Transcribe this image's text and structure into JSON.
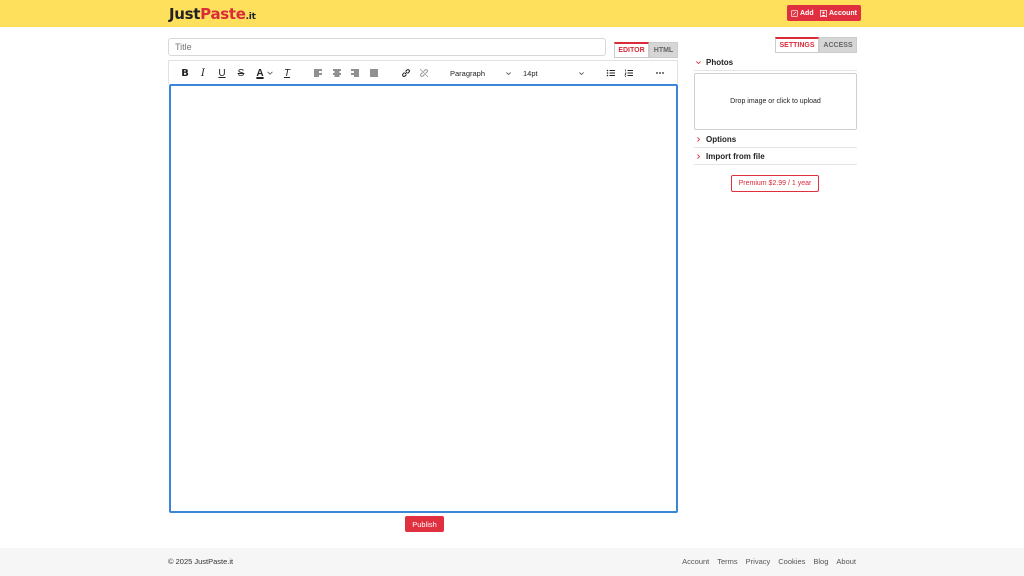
{
  "header": {
    "logo_part1": "Just",
    "logo_part2": "Paste",
    "logo_part3": ".it",
    "add_label": "Add",
    "account_label": "Account",
    "bg_color": "#ffe05c",
    "accent_color": "#e0303f"
  },
  "editor": {
    "title_placeholder": "Title",
    "tabs": [
      {
        "label": "EDITOR",
        "active": true
      },
      {
        "label": "HTML",
        "active": false
      }
    ],
    "toolbar": {
      "buttons": [
        "bold-icon",
        "italic-icon",
        "underline-icon",
        "strikethrough-icon",
        "text-color-icon",
        "clear-formatting-icon",
        "align-left-icon",
        "align-center-icon",
        "align-right-icon",
        "align-justify-icon",
        "link-icon",
        "unlink-icon",
        "bullet-list-icon",
        "numbered-list-icon",
        "more-icon"
      ],
      "block_format": "Paragraph",
      "font_size": "14pt"
    },
    "publish_label": "Publish"
  },
  "sidebar": {
    "tabs": [
      {
        "label": "SETTINGS",
        "active": true
      },
      {
        "label": "ACCESS",
        "active": false
      }
    ],
    "sections": [
      {
        "label": "Photos",
        "expanded": true
      },
      {
        "label": "Options",
        "expanded": false
      },
      {
        "label": "Import from file",
        "expanded": false
      }
    ],
    "dropzone_text": "Drop image or click to upload",
    "premium_label": "Premium $2.99 / 1 year"
  },
  "footer": {
    "copyright": "© 2025 JustPaste.it",
    "links": [
      "Account",
      "Terms",
      "Privacy",
      "Cookies",
      "Blog",
      "About"
    ]
  }
}
